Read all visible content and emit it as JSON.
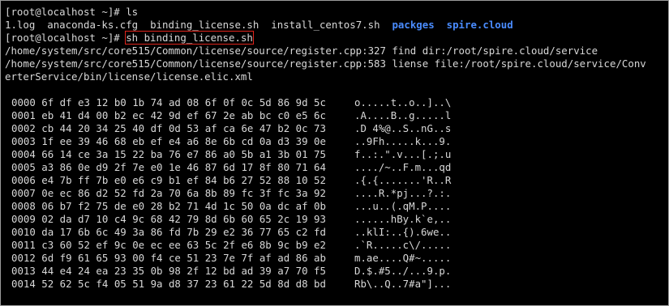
{
  "terminal": {
    "prompt": "[root@localhost ~]# ",
    "cmd1": "ls",
    "ls_output": {
      "files": [
        "1.log",
        "anaconda-ks.cfg",
        "binding_license.sh",
        "install_centos7.sh"
      ],
      "dirs": [
        "packges",
        "spire.cloud"
      ]
    },
    "cmd2": "sh binding_license.sh",
    "output_lines": [
      "/home/system/src/core515/Common/license/source/register.cpp:327 find dir:/root/spire.cloud/service",
      "/home/system/src/core515/Common/license/source/register.cpp:583 liense file:/root/spire.cloud/service/Conv",
      "erterService/bin/license/license.elic.xml"
    ],
    "dump": [
      {
        "offset": "0000",
        "hex": "6f df e3 12 b0 1b 74 ad 08 6f 0f 0c 5d 86 9d 5c",
        "ascii": "o.....t..o..]..\\"
      },
      {
        "offset": "0001",
        "hex": "eb 41 d4 00 b2 ec 42 9d ef 67 2e ab bc c0 e5 6c",
        "ascii": ".A....B..g.....l"
      },
      {
        "offset": "0002",
        "hex": "cb 44 20 34 25 40 df 0d 53 af ca 6e 47 b2 0c 73",
        "ascii": ".D 4%@..S..nG..s"
      },
      {
        "offset": "0003",
        "hex": "1f ee 39 46 68 eb ef e4 a6 8e 6b cd 0a d3 39 0e",
        "ascii": "..9Fh.....k...9."
      },
      {
        "offset": "0004",
        "hex": "66 14 ce 3a 15 22 ba 76 e7 86 a0 5b a1 3b 01 75",
        "ascii": "f..:.\".v...[.;.u"
      },
      {
        "offset": "0005",
        "hex": "a3 86 0e d9 2f 7e e0 1e 46 87 6d 17 8f 80 71 64",
        "ascii": "..../~..F.m...qd"
      },
      {
        "offset": "0006",
        "hex": "e4 7b ff 7b e0 e6 c9 b1 ef 84 b6 27 52 88 10 52",
        "ascii": ".{.{.......'R..R"
      },
      {
        "offset": "0007",
        "hex": "0e ec 86 d2 52 fd 2a 70 6a 8b 89 fc 3f fc 3a 92",
        "ascii": "....R.*pj...?.:."
      },
      {
        "offset": "0008",
        "hex": "06 b7 f2 75 de e0 28 b2 71 4d 1c 50 0a dc af 0b",
        "ascii": "...u..(.qM.P...."
      },
      {
        "offset": "0009",
        "hex": "02 da d7 10 c4 9c 68 42 79 8d 6b 60 65 2c 19 93",
        "ascii": "......hBy.k`e,.."
      },
      {
        "offset": "0010",
        "hex": "da 17 6b 6c 49 3a 86 fd 7b 29 e2 36 77 65 c2 fd",
        "ascii": "..klI:..{).6we.."
      },
      {
        "offset": "0011",
        "hex": "c3 60 52 ef 9c 0e ec ee 63 5c 2f e6 8b 9c b9 e2",
        "ascii": ".`R.....c\\/....."
      },
      {
        "offset": "0012",
        "hex": "6d f9 61 65 93 00 f4 ce 51 23 7e 7f af ad 86 ab",
        "ascii": "m.ae....Q#~....."
      },
      {
        "offset": "0013",
        "hex": "44 e4 24 ea 23 35 0b 98 2f 12 bd ad 39 a7 70 f5",
        "ascii": "D.$.#5../...9.p."
      },
      {
        "offset": "0014",
        "hex": "52 62 5c f4 05 51 9a d8 37 23 61 22 5d 8d d8 bd",
        "ascii": "Rb\\..Q..7#a\"]..."
      }
    ]
  }
}
